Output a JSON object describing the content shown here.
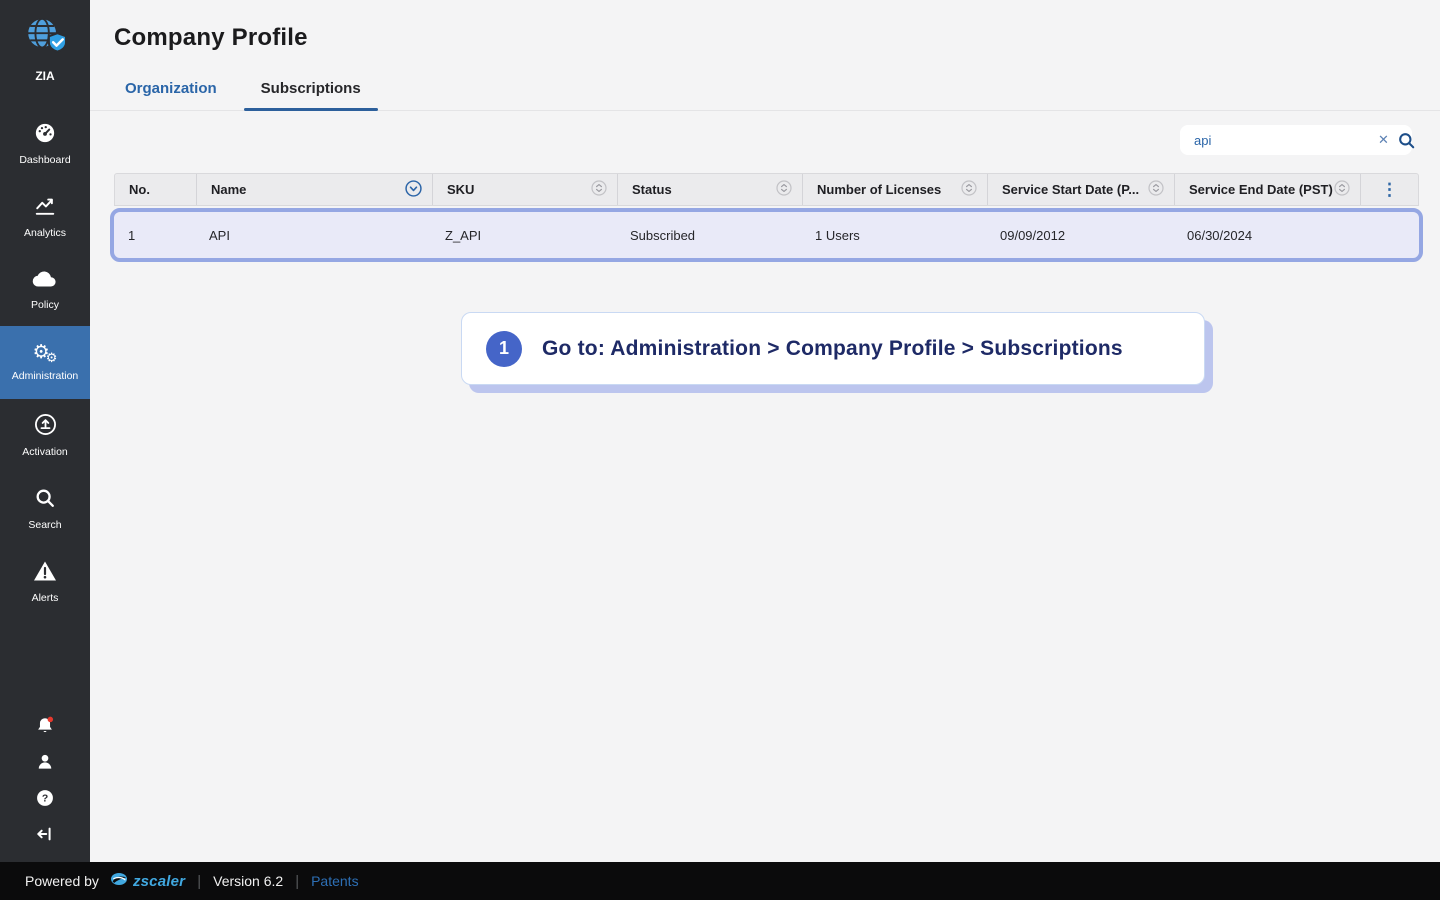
{
  "colors": {
    "sidebar_bg": "#2b2d31",
    "sidebar_active_bg": "#3a70ad",
    "accent_blue": "#2a65a8",
    "tab_underline": "#2c5f9b",
    "row_highlight_border": "#95a7e3",
    "row_highlight_bg": "#e9eaf8",
    "callout_text": "#1e2a66",
    "badge_bg": "#4565c8",
    "brand_blue": "#41a8e0",
    "alert_dot": "#e6392e"
  },
  "sidebar": {
    "logo": {
      "label": "ZIA",
      "icon": "zia-globe-shield-icon"
    },
    "items": [
      {
        "label": "Dashboard",
        "icon": "dashboard-gauge-icon",
        "active": false
      },
      {
        "label": "Analytics",
        "icon": "analytics-chart-icon",
        "active": false
      },
      {
        "label": "Policy",
        "icon": "policy-cloud-icon",
        "active": false
      },
      {
        "label": "Administration",
        "icon": "administration-gears-icon",
        "active": true
      },
      {
        "label": "Activation",
        "icon": "activation-upload-icon",
        "active": false
      },
      {
        "label": "Search",
        "icon": "search-icon",
        "active": false
      },
      {
        "label": "Alerts",
        "icon": "alerts-warning-icon",
        "active": false
      }
    ],
    "bottom_icons": [
      "notifications-bell-icon",
      "user-icon",
      "help-icon",
      "logout-icon"
    ],
    "gear_glyph": "⚙"
  },
  "header": {
    "title": "Company Profile"
  },
  "tabs": [
    {
      "label": "Organization",
      "active": false
    },
    {
      "label": "Subscriptions",
      "active": true
    }
  ],
  "search": {
    "value": "api",
    "clear_glyph": "✕",
    "icon": "search-icon"
  },
  "table": {
    "columns": [
      {
        "label": "No.",
        "sort_icon": "none"
      },
      {
        "label": "Name",
        "sort_icon": "sort-active-desc-icon"
      },
      {
        "label": "SKU",
        "sort_icon": "sort-both-icon"
      },
      {
        "label": "Status",
        "sort_icon": "sort-both-icon"
      },
      {
        "label": "Number of Licenses",
        "sort_icon": "sort-both-icon"
      },
      {
        "label": "Service Start Date (P...",
        "sort_icon": "sort-both-icon"
      },
      {
        "label": "Service End Date (PST)",
        "sort_icon": "sort-both-icon"
      }
    ],
    "menu_glyph": "⋮",
    "rows": [
      [
        "1",
        "API",
        "Z_API",
        "Subscribed",
        "1 Users",
        "09/09/2012",
        "06/30/2024"
      ]
    ]
  },
  "callout": {
    "step": "1",
    "text": "Go to: Administration > Company Profile > Subscriptions"
  },
  "footer": {
    "powered_by": "Powered by",
    "brand": "zscaler",
    "version": "Version 6.2",
    "patents": "Patents"
  }
}
